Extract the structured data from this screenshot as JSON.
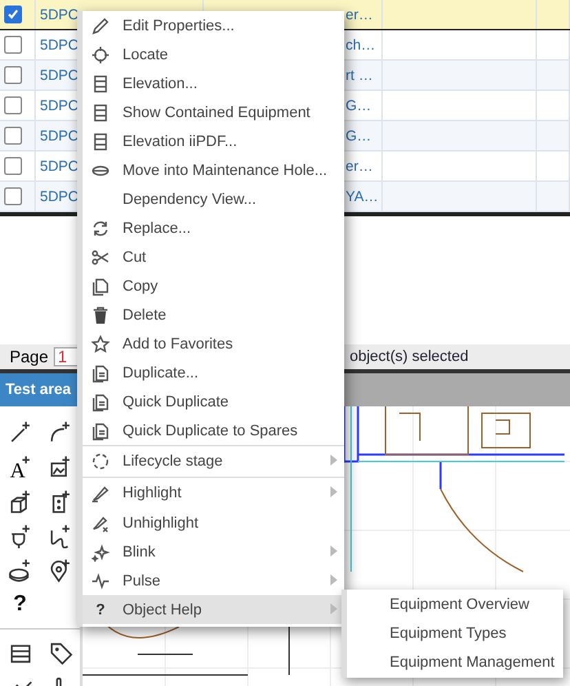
{
  "table": {
    "rows": [
      {
        "selected": true,
        "column_2": "5DPC",
        "column_3": "er…"
      },
      {
        "selected": false,
        "column_2": "5DPC",
        "column_3": "ch…"
      },
      {
        "selected": false,
        "column_2": "5DPC",
        "column_3": "rt …"
      },
      {
        "selected": false,
        "column_2": "5DPC",
        "column_3": "G…"
      },
      {
        "selected": false,
        "column_2": "5DPC",
        "column_3": "G…"
      },
      {
        "selected": false,
        "column_2": "5DPC",
        "column_3": "er…"
      },
      {
        "selected": false,
        "column_2": "5DPC",
        "column_3": "YA…"
      }
    ]
  },
  "status_bar": {
    "page_label": "Page",
    "page_value": "1",
    "selection": "object(s) selected"
  },
  "tabs": [
    {
      "label": "Test area",
      "selected": true
    }
  ],
  "toolbar": {
    "text_tool_glyph": "A",
    "help_glyph": "?"
  },
  "context_menu": {
    "items": [
      {
        "label": "Edit Properties...",
        "submenu": false,
        "separator_before": false,
        "selected": false
      },
      {
        "label": "Locate",
        "submenu": false,
        "separator_before": false,
        "selected": false
      },
      {
        "label": "Elevation...",
        "submenu": false,
        "separator_before": false,
        "selected": false
      },
      {
        "label": "Show Contained Equipment",
        "submenu": false,
        "separator_before": false,
        "selected": false
      },
      {
        "label": "Elevation iiPDF...",
        "submenu": false,
        "separator_before": false,
        "selected": false
      },
      {
        "label": "Move into Maintenance Hole...",
        "submenu": false,
        "separator_before": false,
        "selected": false
      },
      {
        "label": "Dependency View...",
        "submenu": false,
        "separator_before": false,
        "selected": false
      },
      {
        "label": "Replace...",
        "submenu": false,
        "separator_before": false,
        "selected": false
      },
      {
        "label": "Cut",
        "submenu": false,
        "separator_before": false,
        "selected": false
      },
      {
        "label": "Copy",
        "submenu": false,
        "separator_before": false,
        "selected": false
      },
      {
        "label": "Delete",
        "submenu": false,
        "separator_before": false,
        "selected": false
      },
      {
        "label": "Add to Favorites",
        "submenu": false,
        "separator_before": false,
        "selected": false
      },
      {
        "label": "Duplicate...",
        "submenu": false,
        "separator_before": false,
        "selected": false
      },
      {
        "label": "Quick Duplicate",
        "submenu": false,
        "separator_before": false,
        "selected": false
      },
      {
        "label": "Quick Duplicate to Spares",
        "submenu": false,
        "separator_before": false,
        "selected": false
      },
      {
        "label": "Lifecycle stage",
        "submenu": true,
        "separator_before": true,
        "selected": false
      },
      {
        "label": "Highlight",
        "submenu": true,
        "separator_before": true,
        "selected": false
      },
      {
        "label": "Unhighlight",
        "submenu": false,
        "separator_before": false,
        "selected": false
      },
      {
        "label": "Blink",
        "submenu": true,
        "separator_before": false,
        "selected": false
      },
      {
        "label": "Pulse",
        "submenu": true,
        "separator_before": false,
        "selected": false
      },
      {
        "label": "Object Help",
        "glyph": "?",
        "submenu": true,
        "separator_before": false,
        "selected": true
      }
    ]
  },
  "submenu": {
    "items": [
      {
        "label": "Equipment Overview"
      },
      {
        "label": "Equipment Types"
      },
      {
        "label": "Equipment Management"
      }
    ]
  }
}
